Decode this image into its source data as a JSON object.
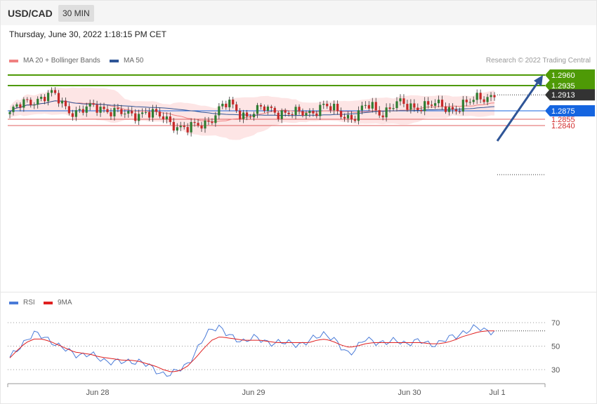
{
  "header": {
    "symbol": "USD/CAD",
    "timeframe": "30 MIN"
  },
  "subheader": {
    "datetime": "Thursday, June 30, 2022 1:18:15 PM CET"
  },
  "legend_main": [
    {
      "label": "MA 20 + Bollinger Bands",
      "color": "#f08080"
    },
    {
      "label": "MA 50",
      "color": "#2f5597"
    }
  ],
  "legend_rsi": [
    {
      "label": "RSI",
      "color": "#4a7bd8"
    },
    {
      "label": "9MA",
      "color": "#e02020"
    }
  ],
  "copyright": "Research © 2022 Trading Central",
  "colors": {
    "up": "#2e7d32",
    "down": "#c62828",
    "resistance": "#4e9a06",
    "pivot": "#1565e0",
    "support": "#e06060",
    "bands": "#fde0e0",
    "arrow": "#2f5597",
    "last": "#333333"
  },
  "chart_data": {
    "type": "candlestick",
    "symbol": "USD/CAD",
    "timeframe": "30 MIN",
    "ylim": [
      1.282,
      1.2975
    ],
    "x_ticks": [
      "Jun 28",
      "Jun 29",
      "Jun 30",
      "Jul 1"
    ],
    "levels": [
      {
        "value": 1.296,
        "label": "1.2960",
        "kind": "resistance"
      },
      {
        "value": 1.2935,
        "label": "1.2935",
        "kind": "resistance"
      },
      {
        "value": 1.2913,
        "label": "1.2913",
        "kind": "last"
      },
      {
        "value": 1.2875,
        "label": "1.2875",
        "kind": "pivot"
      },
      {
        "value": 1.2855,
        "label": "1.2855",
        "kind": "support"
      },
      {
        "value": 1.284,
        "label": "1.2840",
        "kind": "support"
      }
    ],
    "price_path": [
      1.2868,
      1.2882,
      1.289,
      1.2896,
      1.29,
      1.2904,
      1.291,
      1.2914,
      1.2906,
      1.289,
      1.2878,
      1.2872,
      1.2874,
      1.288,
      1.2882,
      1.2884,
      1.288,
      1.2876,
      1.2872,
      1.2868,
      1.2864,
      1.2866,
      1.287,
      1.2874,
      1.2868,
      1.2862,
      1.2858,
      1.285,
      1.2842,
      1.2836,
      1.2832,
      1.2836,
      1.284,
      1.2846,
      1.2856,
      1.2872,
      1.2886,
      1.2892,
      1.288,
      1.287,
      1.2864,
      1.287,
      1.2876,
      1.288,
      1.2878,
      1.2874,
      1.2872,
      1.287,
      1.2868,
      1.2868,
      1.287,
      1.2872,
      1.288,
      1.2888,
      1.2882,
      1.2874,
      1.2868,
      1.2862,
      1.286,
      1.287,
      1.2884,
      1.2886,
      1.2876,
      1.287,
      1.288,
      1.289,
      1.2892,
      1.2886,
      1.2884,
      1.2886,
      1.2888,
      1.289,
      1.2888,
      1.2886,
      1.2882,
      1.288,
      1.2884,
      1.289,
      1.2896,
      1.2904,
      1.2908,
      1.291,
      1.2913
    ],
    "rsi": {
      "ylim": [
        20,
        75
      ],
      "levels": [
        70,
        50,
        30
      ],
      "rsi_path": [
        39,
        48,
        56,
        60,
        58,
        56,
        50,
        46,
        44,
        43,
        42,
        40,
        38,
        36,
        36,
        38,
        37,
        33,
        30,
        27,
        25,
        30,
        36,
        44,
        56,
        66,
        67,
        58,
        56,
        55,
        57,
        55,
        54,
        53,
        52,
        53,
        52,
        53,
        58,
        62,
        56,
        48,
        44,
        50,
        55,
        54,
        54,
        53,
        54,
        53,
        54,
        53,
        52,
        53,
        55,
        58,
        62,
        64,
        65,
        64,
        63
      ],
      "ma_path": [
        40,
        47,
        53,
        56,
        56,
        54,
        51,
        48,
        45,
        44,
        43,
        41,
        40,
        39,
        38,
        38,
        37,
        35,
        33,
        30,
        28,
        29,
        33,
        40,
        48,
        55,
        58,
        57,
        56,
        55,
        55,
        55,
        54,
        53,
        53,
        53,
        53,
        53,
        55,
        56,
        54,
        51,
        49,
        50,
        52,
        53,
        53,
        53,
        53,
        53,
        53,
        53,
        52,
        52,
        53,
        55,
        58,
        60,
        62,
        63,
        63
      ],
      "last_rsi": 63
    }
  }
}
